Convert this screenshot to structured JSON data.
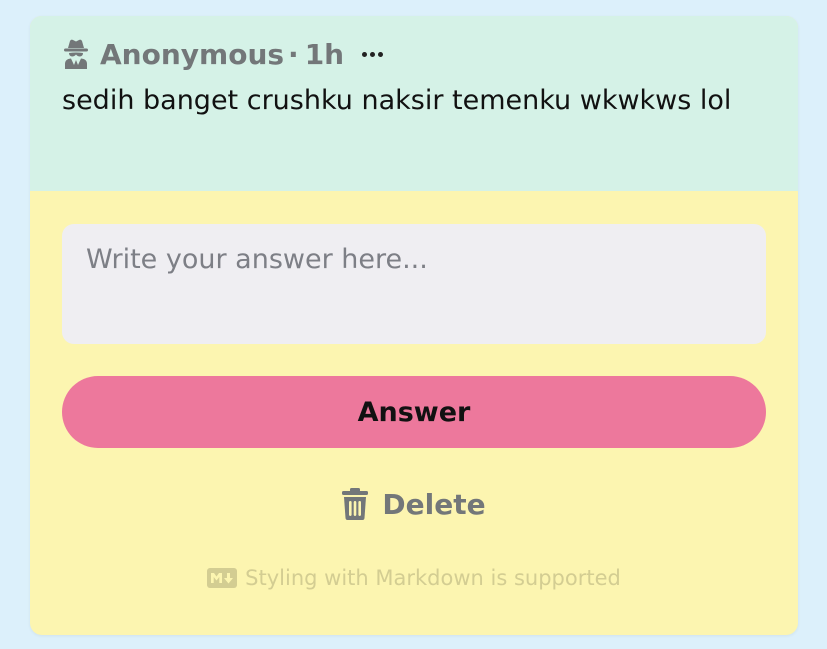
{
  "post": {
    "author": "Anonymous",
    "separator": "·",
    "time": "1h",
    "text": "sedih banget crushku naksir temenku wkwkws lol",
    "author_icon": "spy-icon",
    "menu_icon": "more-icon"
  },
  "answer_form": {
    "placeholder": "Write your answer here...",
    "value": "",
    "submit_label": "Answer",
    "delete_label": "Delete",
    "delete_icon": "trash-icon",
    "markdown_note": "Styling with Markdown is supported",
    "markdown_icon": "markdown-icon"
  },
  "colors": {
    "page_background": "#dcf0fb",
    "question_background": "#d5f2e7",
    "card_background": "#fcf5b0",
    "input_background": "#efeef2",
    "answer_button": "#ed789c",
    "muted_text": "#737779"
  }
}
